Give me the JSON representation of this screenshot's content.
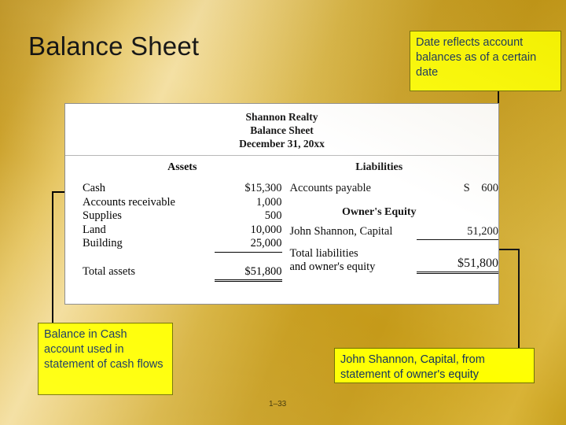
{
  "slide": {
    "title": "Balance Sheet",
    "page_number": "1–33",
    "accent_callout_bg": "#ffff00",
    "accent_callout_text": "#10305c"
  },
  "callouts": [
    {
      "name": "date-callout",
      "text": "Date reflects account balances as of a certain date"
    },
    {
      "name": "cash-callout",
      "text": "Balance in Cash account used in statement of cash flows"
    },
    {
      "name": "capital-callout",
      "text": "John Shannon, Capital, from statement of owner's equity"
    }
  ],
  "statement": {
    "company": "Shannon Realty",
    "title": "Balance Sheet",
    "date": "December 31, 20xx",
    "assets_heading": "Assets",
    "liabilities_heading": "Liabilities",
    "equity_heading": "Owner's Equity",
    "assets": [
      {
        "label": "Cash",
        "amount": "$15,300"
      },
      {
        "label": "Accounts receivable",
        "amount": "1,000"
      },
      {
        "label": "Supplies",
        "amount": "500"
      },
      {
        "label": "Land",
        "amount": "10,000"
      },
      {
        "label": "Building",
        "amount": "25,000"
      }
    ],
    "assets_total": {
      "label": "Total assets",
      "amount": "$51,800"
    },
    "liabilities": [
      {
        "label": "Accounts payable",
        "amount": "S    600"
      }
    ],
    "equity": [
      {
        "label": "John Shannon, Capital",
        "amount": "51,200"
      }
    ],
    "liabilities_equity_total": {
      "label_line1": "Total liabilities",
      "label_line2": "and owner's equity",
      "amount": "$51,800"
    }
  }
}
